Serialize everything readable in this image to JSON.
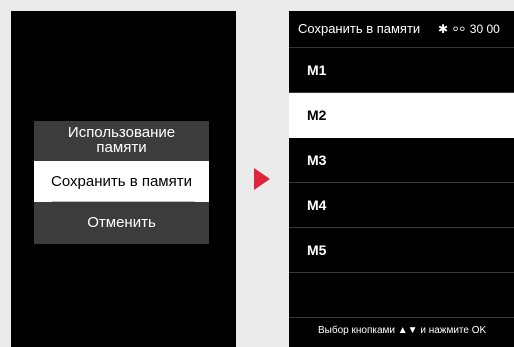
{
  "left_screen": {
    "popup": {
      "title_line1": "Использование",
      "title_line2": "памяти",
      "selected_option": "Сохранить в памяти",
      "cancel_option": "Отменить"
    }
  },
  "right_screen": {
    "header": {
      "title": "Сохранить в памяти",
      "bluetooth_icon": "✱",
      "signal_icon": "⸰⸰",
      "status_value": "30 00"
    },
    "items": [
      {
        "label": "M1",
        "selected": false
      },
      {
        "label": "M2",
        "selected": true
      },
      {
        "label": "M3",
        "selected": false
      },
      {
        "label": "M4",
        "selected": false
      },
      {
        "label": "M5",
        "selected": false
      }
    ],
    "footer": "Выбор кнопками ▲▼ и нажмите OK"
  },
  "colors": {
    "arrow": "#e0243c",
    "popup_bg": "#3c3c3c",
    "screen_bg": "#000000",
    "page_bg": "#ebebeb"
  }
}
